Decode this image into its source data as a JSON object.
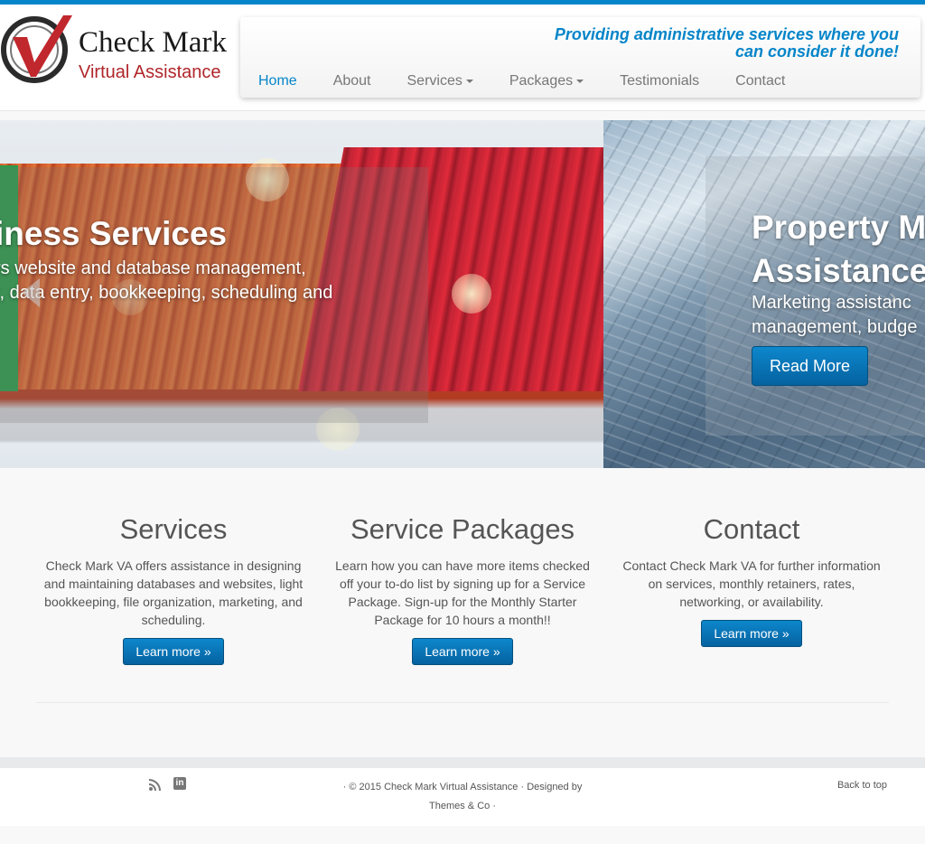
{
  "brand": {
    "name": "Check Mark",
    "subtitle": "Virtual Assistance",
    "colors": {
      "accent": "#0585c9",
      "logo_red": "#b0262a"
    }
  },
  "header": {
    "tagline_line1": "Providing administrative services where you",
    "tagline_line2": "can consider it done!"
  },
  "nav": {
    "items": [
      {
        "label": "Home",
        "active": true
      },
      {
        "label": "About"
      },
      {
        "label": "Services",
        "dropdown": true
      },
      {
        "label": "Packages",
        "dropdown": true
      },
      {
        "label": "Testimonials"
      },
      {
        "label": "Contact"
      }
    ]
  },
  "slider": {
    "slides": [
      {
        "title": "iness Services",
        "text_line1": "rs website and database management,",
        "text_line2": "t, data entry, bookkeeping, scheduling and"
      },
      {
        "title_line1": "Property M",
        "title_line2": "Assistance",
        "text_line1": "Marketing assistanc",
        "text_line2": "management, budge",
        "button": "Read More"
      }
    ]
  },
  "features": [
    {
      "title": "Services",
      "text": "Check Mark VA offers assistance in designing and maintaining databases and websites, light bookkeeping, file organization, marketing, and scheduling.",
      "button": "Learn more »"
    },
    {
      "title": "Service Packages",
      "text": "Learn how you can have more items checked off your to-do list by signing up for a Service Package. Sign-up for the Monthly Starter Package for 10 hours a month!!",
      "button": "Learn more »"
    },
    {
      "title": "Contact",
      "text": "Contact Check Mark VA for further information on services, monthly retainers, rates, networking, or availability.",
      "button": "Learn more »"
    }
  ],
  "footer": {
    "social": [
      "rss-icon",
      "linkedin-icon"
    ],
    "linkedin_glyph": "in",
    "copyright_line1": "· © 2015 Check Mark Virtual Assistance · Designed by",
    "copyright_line2": "Themes & Co ·",
    "back_to_top": "Back to top"
  }
}
